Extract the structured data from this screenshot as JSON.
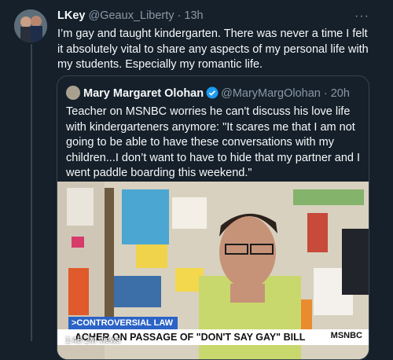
{
  "tweet": {
    "author": "LKey",
    "handle": "@Geaux_Liberty",
    "time": "13h",
    "text": "I’m gay and taught kindergarten. There was never a time I felt it absolutely vital to share any aspects of my personal life with my students. Especially my romantic life."
  },
  "quote": {
    "author": "Mary Margaret Olohan",
    "handle": "@MaryMargOlohan",
    "time": "20h",
    "text": "Teacher on MSNBC worries he can't discuss his love life with kindergarteners anymore: \"It scares me that I am not going to be able to have these conversations with my children...I don’t want to have to hide that my partner and I went paddle boarding this weekend.\""
  },
  "video": {
    "banner": ">CONTROVERSIAL LAW",
    "headline": "ACHER ON PASSAGE OF \"DON'T SAY GAY\" BILL",
    "network": "MSNBC",
    "stats": "1:48  2M views"
  },
  "colors": {
    "bg": "#15202b",
    "border": "#38444d",
    "muted": "#8b98a5",
    "verified": "#1d9bf0"
  }
}
